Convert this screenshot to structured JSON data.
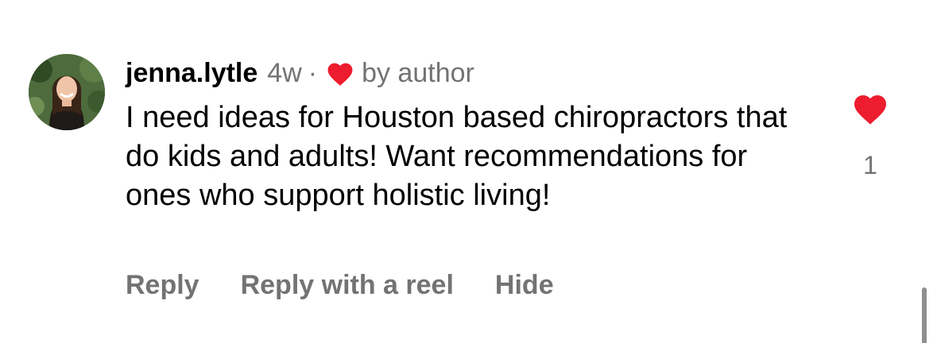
{
  "comment": {
    "username": "jenna.lytle",
    "time_ago": "4w",
    "separator": "·",
    "liked_by_author_label": "by author",
    "text": "I need ideas for Houston based chiropractors that do kids and adults! Want recommendations for ones who support holistic living!",
    "like_count": "1",
    "like_icon": "heart-filled-icon",
    "author_heart_icon": "heart-filled-icon"
  },
  "actions": {
    "reply_label": "Reply",
    "reply_with_reel_label": "Reply with a reel",
    "hide_label": "Hide"
  },
  "colors": {
    "heart": "#ed1c2e",
    "secondary_text": "#737373",
    "primary_text": "#000000",
    "background": "#ffffff"
  }
}
